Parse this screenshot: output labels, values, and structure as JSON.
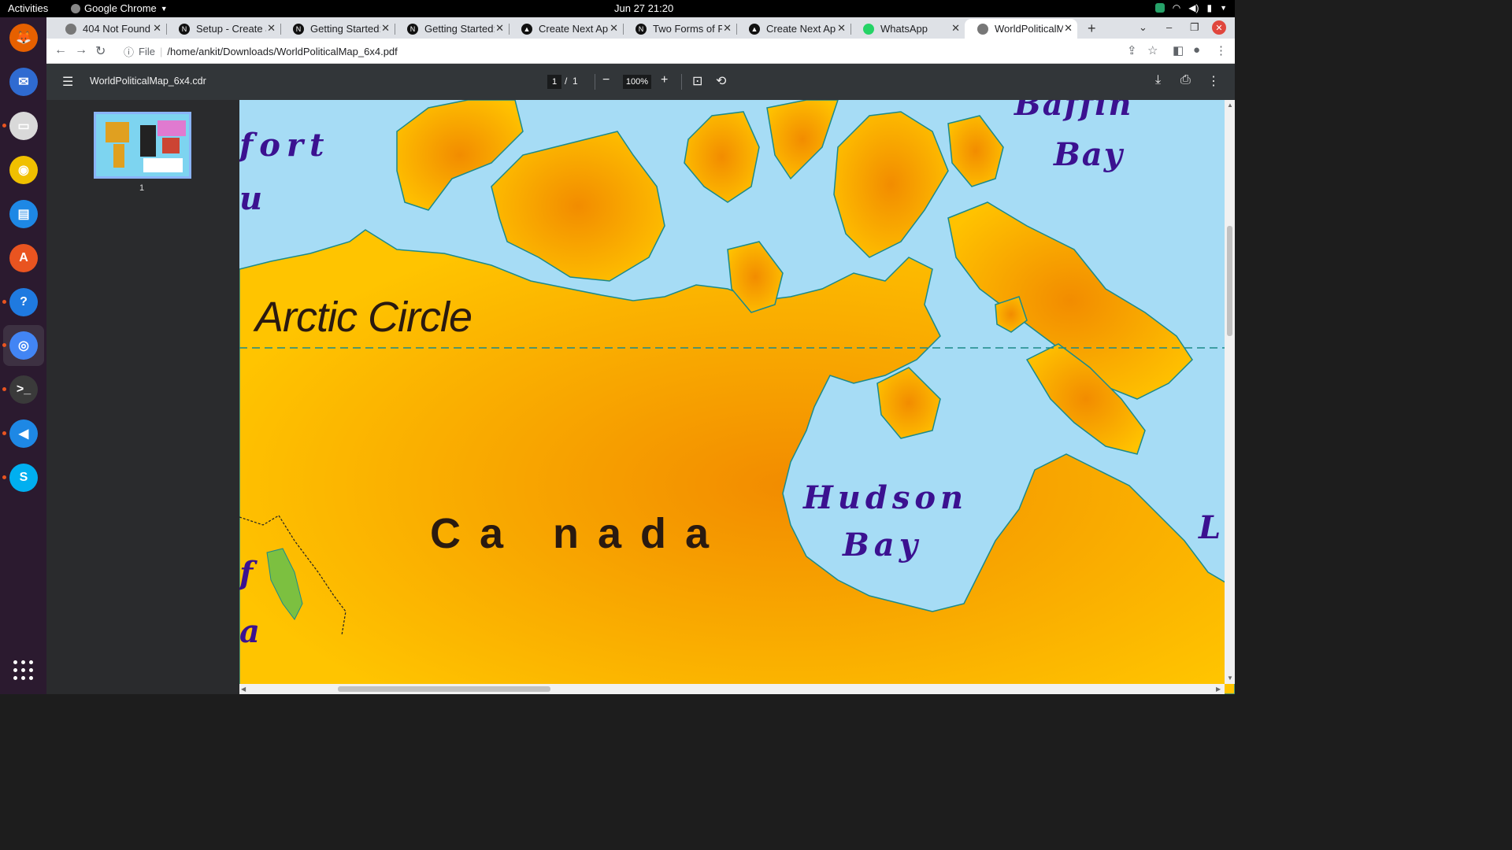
{
  "topbar": {
    "activities": "Activities",
    "app_name": "Google Chrome",
    "clock": "Jun 27  21:20"
  },
  "dock": {
    "items": [
      {
        "name": "firefox-icon",
        "glyph": "🦊",
        "color": "#e66000"
      },
      {
        "name": "thunderbird-icon",
        "glyph": "✉",
        "color": "#2f6bd1"
      },
      {
        "name": "files-icon",
        "glyph": "▭",
        "color": "#d9d9d9"
      },
      {
        "name": "rhythmbox-icon",
        "glyph": "◉",
        "color": "#f0c000"
      },
      {
        "name": "writer-icon",
        "glyph": "▤",
        "color": "#1e88e5"
      },
      {
        "name": "software-icon",
        "glyph": "A",
        "color": "#e95420"
      },
      {
        "name": "help-icon",
        "glyph": "?",
        "color": "#1f7ae0"
      },
      {
        "name": "chrome-icon",
        "glyph": "◎",
        "color": "#4285f4"
      },
      {
        "name": "terminal-icon",
        "glyph": ">_",
        "color": "#3a3a3a"
      },
      {
        "name": "vscode-icon",
        "glyph": "◀",
        "color": "#1e88e5"
      },
      {
        "name": "skype-icon",
        "glyph": "S",
        "color": "#00aff0"
      }
    ]
  },
  "tabs": [
    {
      "title": "404 Not Found",
      "favicon": "globe"
    },
    {
      "title": "Setup - Create a N",
      "favicon": "N"
    },
    {
      "title": "Getting Started:",
      "favicon": "N"
    },
    {
      "title": "Getting Started:",
      "favicon": "N"
    },
    {
      "title": "Create Next App",
      "favicon": "▲"
    },
    {
      "title": "Two Forms of Pr",
      "favicon": "N"
    },
    {
      "title": "Create Next App",
      "favicon": "▲"
    },
    {
      "title": "WhatsApp",
      "favicon": "wa"
    },
    {
      "title": "WorldPoliticalM",
      "favicon": "globe"
    }
  ],
  "address": {
    "scheme": "File",
    "url": "/home/ankit/Downloads/WorldPoliticalMap_6x4.pdf"
  },
  "pdf": {
    "doc_name": "WorldPoliticalMap_6x4.cdr",
    "page_current": "1",
    "page_sep": "/",
    "page_total": "1",
    "zoom": "100%",
    "thumb_label": "1"
  },
  "map": {
    "labels": {
      "baffin_1": "Baffin",
      "baffin_2": "Bay",
      "fort": "fort",
      "frag_u": "u",
      "frag_f": "f",
      "frag_a": "a",
      "arctic_circle": "Arctic Circle",
      "canada": "Ca nada",
      "hudson_1": "Hudson",
      "hudson_2": "Bay",
      "frag_l": "L"
    },
    "colors": {
      "water": "#a6dcf5",
      "land_light": "#ffc400",
      "land_dark": "#f28c00",
      "coast": "#1b8a8a",
      "label": "#3b1190"
    }
  }
}
